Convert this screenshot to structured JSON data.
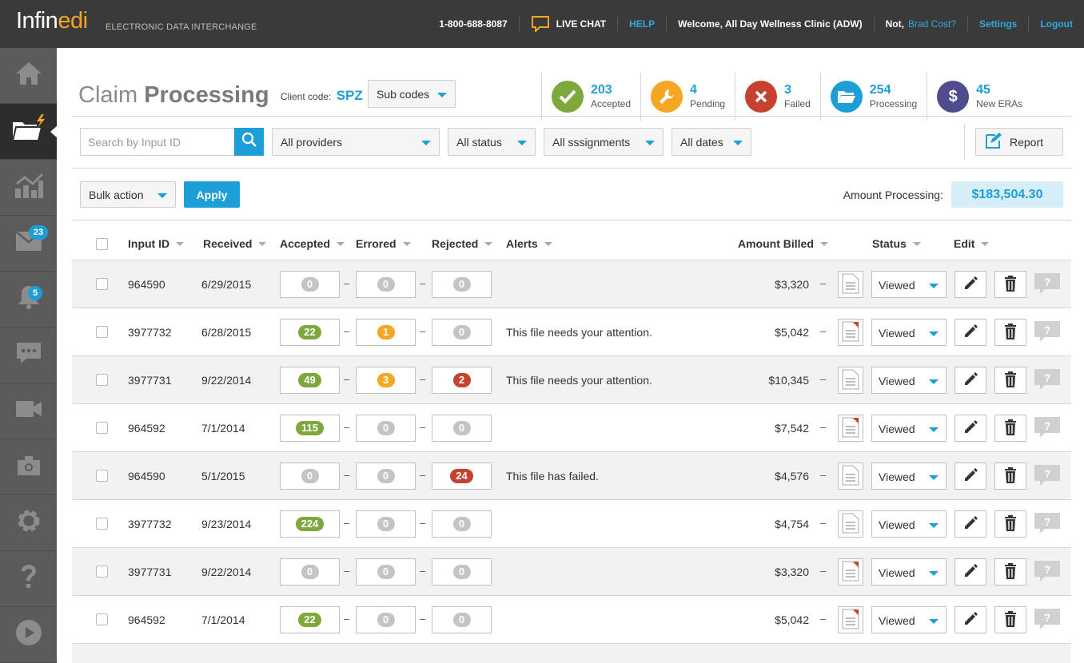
{
  "header": {
    "logo_main": "Infin",
    "logo_accent": "edi",
    "logo_sub": "ELECTRONIC DATA INTERCHANGE",
    "phone": "1-800-688-8087",
    "live_chat": "LIVE CHAT",
    "help": "HELP",
    "welcome": "Welcome, All Day Wellness Clinic (ADW)",
    "not_prefix": "Not,",
    "not_user": "Brad Cost?",
    "settings": "Settings",
    "logout": "Logout"
  },
  "sidebar": {
    "items": [
      {
        "icon": "home-icon"
      },
      {
        "icon": "folder-icon",
        "active": true
      },
      {
        "icon": "chart-icon"
      },
      {
        "icon": "mail-icon",
        "badge": "23"
      },
      {
        "icon": "bell-icon",
        "badge": "5"
      },
      {
        "icon": "chat-icon"
      },
      {
        "icon": "video-icon"
      },
      {
        "icon": "camera-icon"
      },
      {
        "icon": "gear-icon"
      },
      {
        "icon": "help-icon"
      },
      {
        "icon": "play-icon"
      }
    ]
  },
  "page": {
    "title_light": "Claim",
    "title_bold": "Processing",
    "client_label": "Client code:",
    "client_code": "SPZ",
    "subcodes": "Sub codes"
  },
  "stats": [
    {
      "num": "203",
      "label": "Accepted",
      "color": "#7ea73d",
      "icon": "check-icon"
    },
    {
      "num": "4",
      "label": "Pending",
      "color": "#f6a623",
      "icon": "wrench-icon"
    },
    {
      "num": "3",
      "label": "Failed",
      "color": "#c5422f",
      "icon": "x-icon"
    },
    {
      "num": "254",
      "label": "Processing",
      "color": "#1e9ed6",
      "icon": "folder-open-icon"
    },
    {
      "num": "45",
      "label": "New ERAs",
      "color": "#4f4c8c",
      "icon": "dollar-icon"
    }
  ],
  "filters": {
    "search_placeholder": "Search by Input ID",
    "providers": "All providers",
    "status": "All status",
    "assignments": "All sssignments",
    "dates": "All dates",
    "report": "Report"
  },
  "actions": {
    "bulk": "Bulk action",
    "apply": "Apply",
    "amount_label": "Amount Processing:",
    "amount_value": "$183,504.30"
  },
  "table": {
    "headers": {
      "input_id": "Input ID",
      "received": "Received",
      "accepted": "Accepted",
      "errored": "Errored",
      "rejected": "Rejected",
      "alerts": "Alerts",
      "amount": "Amount Billed",
      "status": "Status",
      "edit": "Edit"
    },
    "rows": [
      {
        "id": "964590",
        "received": "6/29/2015",
        "accepted": "0",
        "errored": "0",
        "rejected": "0",
        "alert": "",
        "amount": "$3,320",
        "status": "Viewed",
        "doc_flag": false
      },
      {
        "id": "3977732",
        "received": "6/28/2015",
        "accepted": "22",
        "errored": "1",
        "rejected": "0",
        "alert": "This file needs your attention.",
        "amount": "$5,042",
        "status": "Viewed",
        "doc_flag": true
      },
      {
        "id": "3977731",
        "received": "9/22/2014",
        "accepted": "49",
        "errored": "3",
        "rejected": "2",
        "alert": "This file needs your attention.",
        "amount": "$10,345",
        "status": "Viewed",
        "doc_flag": false
      },
      {
        "id": "964592",
        "received": "7/1/2014",
        "accepted": "115",
        "errored": "0",
        "rejected": "0",
        "alert": "",
        "amount": "$7,542",
        "status": "Viewed",
        "doc_flag": true
      },
      {
        "id": "964590",
        "received": "5/1/2015",
        "accepted": "0",
        "errored": "0",
        "rejected": "24",
        "alert": "This file has failed.",
        "amount": "$4,576",
        "status": "Viewed",
        "doc_flag": false
      },
      {
        "id": "3977732",
        "received": "9/23/2014",
        "accepted": "224",
        "errored": "0",
        "rejected": "0",
        "alert": "",
        "amount": "$4,754",
        "status": "Viewed",
        "doc_flag": false
      },
      {
        "id": "3977731",
        "received": "9/22/2014",
        "accepted": "0",
        "errored": "0",
        "rejected": "0",
        "alert": "",
        "amount": "$3,320",
        "status": "Viewed",
        "doc_flag": true
      },
      {
        "id": "964592",
        "received": "7/1/2014",
        "accepted": "22",
        "errored": "0",
        "rejected": "0",
        "alert": "",
        "amount": "$5,042",
        "status": "Viewed",
        "doc_flag": true
      }
    ]
  },
  "colors": {
    "accent": "#1e9ed6",
    "accepted": "#7ea73d",
    "errored": "#f6a623",
    "rejected": "#c5422f",
    "zero": "#c4c4c4"
  }
}
